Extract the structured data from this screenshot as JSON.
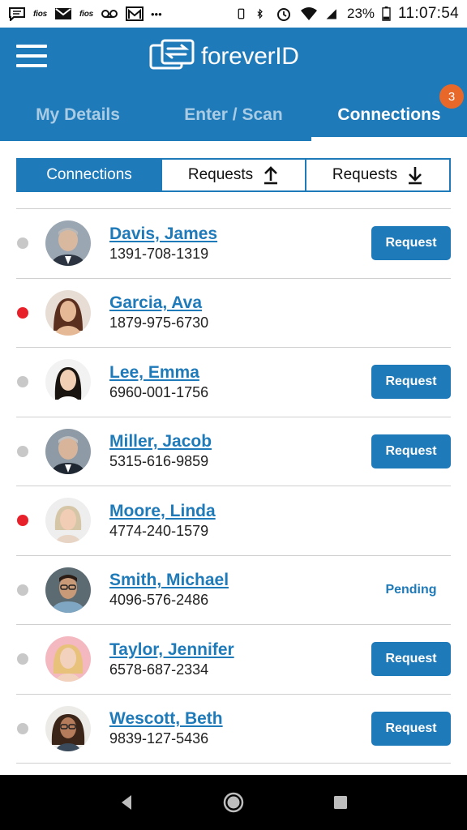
{
  "status_bar": {
    "fios_label": "fios",
    "fios2_label": "fios",
    "more": "•••",
    "battery_pct": "23%",
    "time": "11:07:54"
  },
  "app": {
    "logo_text": "foreverID"
  },
  "tabs": [
    {
      "label": "My Details",
      "active": false
    },
    {
      "label": "Enter / Scan",
      "active": false
    },
    {
      "label": "Connections",
      "active": true,
      "badge": "3"
    }
  ],
  "segments": [
    {
      "label": "Connections",
      "active": true,
      "icon": ""
    },
    {
      "label": "Requests",
      "active": false,
      "icon": "arrow-up-icon"
    },
    {
      "label": "Requests",
      "active": false,
      "icon": "arrow-down-icon"
    }
  ],
  "colors": {
    "primary": "#1f7ab9",
    "badge": "#e8682a",
    "online_dot": "#e8202a",
    "offline_dot": "#c8c8c8"
  },
  "contacts": [
    {
      "name": "Davis, James",
      "phone": "1391-708-1319",
      "status": "offline",
      "action": "Request"
    },
    {
      "name": "Garcia, Ava",
      "phone": "1879-975-6730",
      "status": "online",
      "action": ""
    },
    {
      "name": "Lee, Emma",
      "phone": "6960-001-1756",
      "status": "offline",
      "action": "Request"
    },
    {
      "name": "Miller, Jacob",
      "phone": "5315-616-9859",
      "status": "offline",
      "action": "Request"
    },
    {
      "name": "Moore, Linda",
      "phone": "4774-240-1579",
      "status": "online",
      "action": ""
    },
    {
      "name": "Smith, Michael",
      "phone": "4096-576-2486",
      "status": "offline",
      "action": "Pending"
    },
    {
      "name": "Taylor, Jennifer",
      "phone": "6578-687-2334",
      "status": "offline",
      "action": "Request"
    },
    {
      "name": "Wescott, Beth",
      "phone": "9839-127-5436",
      "status": "offline",
      "action": "Request"
    }
  ]
}
